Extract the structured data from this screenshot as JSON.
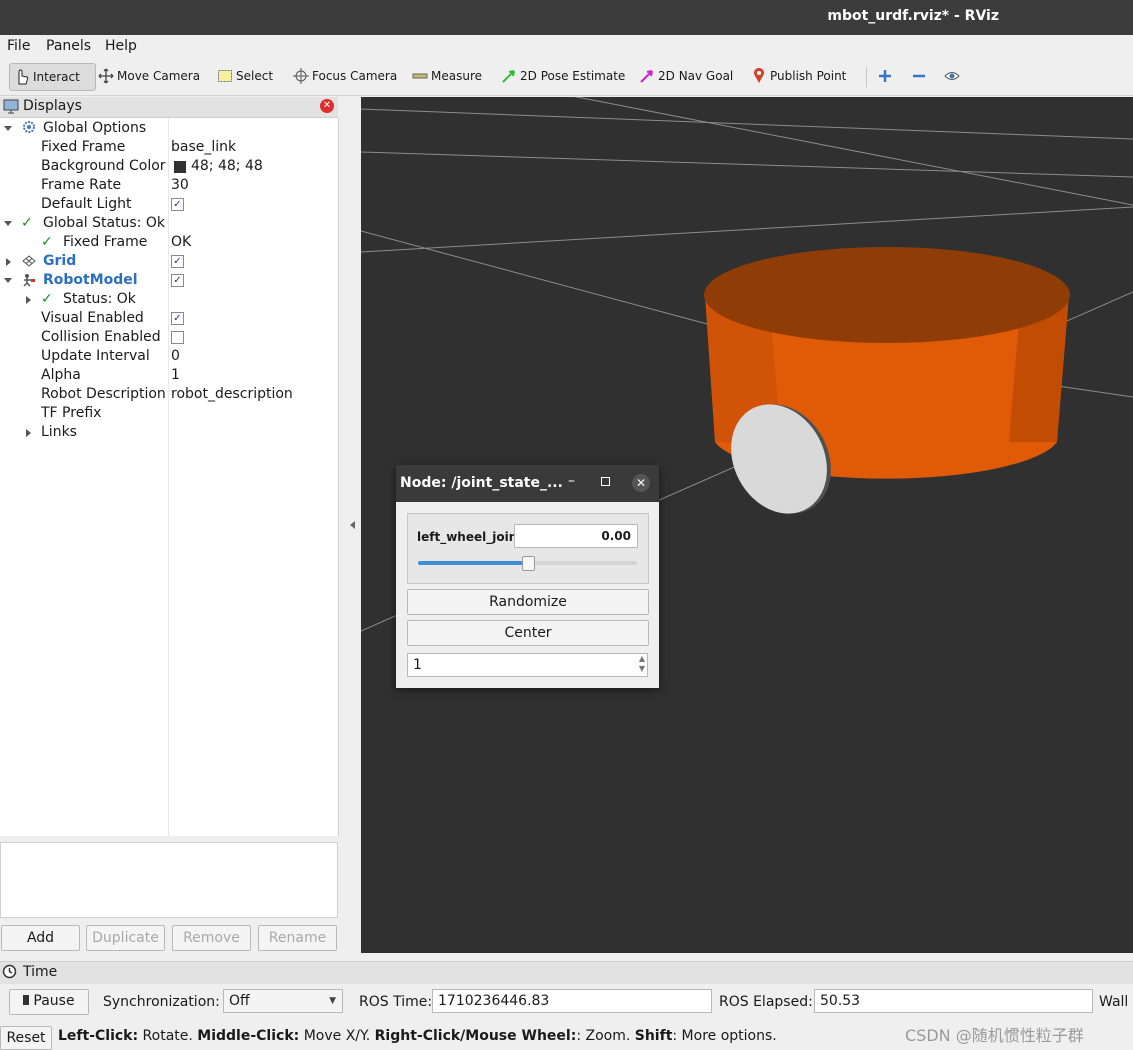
{
  "window": {
    "title": "mbot_urdf.rviz* - RViz"
  },
  "menu": {
    "file": "File",
    "panels": "Panels",
    "help": "Help"
  },
  "toolbar": {
    "interact": "Interact",
    "move_camera": "Move Camera",
    "select": "Select",
    "focus_camera": "Focus Camera",
    "measure": "Measure",
    "pose_estimate": "2D Pose Estimate",
    "nav_goal": "2D Nav Goal",
    "publish_point": "Publish Point"
  },
  "displays": {
    "title": "Displays",
    "global_options": "Global Options",
    "fixed_frame_label": "Fixed Frame",
    "fixed_frame_value": "base_link",
    "bg_color_label": "Background Color",
    "bg_color_value": "48; 48; 48",
    "frame_rate_label": "Frame Rate",
    "frame_rate_value": "30",
    "default_light_label": "Default Light",
    "global_status_label": "Global Status: Ok",
    "fixed_frame_status_label": "Fixed Frame",
    "fixed_frame_status_value": "OK",
    "grid_label": "Grid",
    "robotmodel_label": "RobotModel",
    "status_ok_label": "Status: Ok",
    "visual_enabled_label": "Visual Enabled",
    "collision_enabled_label": "Collision Enabled",
    "update_interval_label": "Update Interval",
    "update_interval_value": "0",
    "alpha_label": "Alpha",
    "alpha_value": "1",
    "robot_desc_label": "Robot Description",
    "robot_desc_value": "robot_description",
    "tf_prefix_label": "TF Prefix",
    "links_label": "Links",
    "checks": {
      "default_light": true,
      "grid": true,
      "robotmodel": true,
      "visual_enabled": true,
      "collision_enabled": false
    },
    "buttons": {
      "add": "Add",
      "duplicate": "Duplicate",
      "remove": "Remove",
      "rename": "Rename"
    }
  },
  "joint_dialog": {
    "title": "Node: /joint_state_...",
    "joint_name": "left_wheel_joint",
    "joint_value": "0.00",
    "slider_fraction": 0.5,
    "randomize": "Randomize",
    "center": "Center",
    "spin_value": "1"
  },
  "time_panel": {
    "title": "Time",
    "pause": "Pause",
    "sync_label": "Synchronization:",
    "sync_value": "Off",
    "ros_time_label": "ROS Time:",
    "ros_time_value": "1710236446.83",
    "ros_elapsed_label": "ROS Elapsed:",
    "ros_elapsed_value": "50.53",
    "wall_label": "Wall"
  },
  "status_bar": {
    "reset": "Reset",
    "left_click_key": "Left-Click:",
    "left_click_desc": " Rotate. ",
    "middle_click_key": "Middle-Click:",
    "middle_click_desc": " Move X/Y. ",
    "right_click_key": "Right-Click/Mouse Wheel:",
    "right_click_desc": ": Zoom. ",
    "shift_key": "Shift",
    "shift_desc": ": More options."
  },
  "watermark": "CSDN @随机惯性粒子群",
  "colors": {
    "background": "#303030",
    "robot_body": "#e05a08",
    "wheel": "#d8d8d8"
  }
}
